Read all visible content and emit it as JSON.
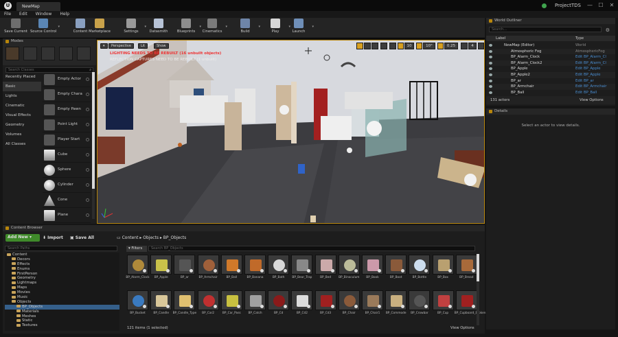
{
  "app": {
    "tab_title": "NewMap",
    "project": "ProjectTDS",
    "close": "✕",
    "minimize": "—",
    "maximize": "☐"
  },
  "menu": [
    "File",
    "Edit",
    "Window",
    "Help"
  ],
  "toolbar": [
    {
      "label": "Save Current",
      "color": "#6e6e6e"
    },
    {
      "label": "Source Control",
      "color": "#5a86b5"
    },
    {
      "label": "Content",
      "color": "#8aa0c0"
    },
    {
      "label": "Marketplace",
      "color": "#c9a24a"
    },
    {
      "label": "Settings",
      "color": "#9a9a9a"
    },
    {
      "label": "Datasmith",
      "color": "#b7c3d6"
    },
    {
      "label": "Blueprints",
      "color": "#8d8d8d"
    },
    {
      "label": "Cinematics",
      "color": "#7a7a7a"
    },
    {
      "label": "Build",
      "color": "#6e85a8"
    },
    {
      "label": "Play",
      "color": "#d6d6d6"
    },
    {
      "label": "Launch",
      "color": "#6f8fb8"
    }
  ],
  "modes": {
    "title": "Modes",
    "search_placeholder": "Search Classes",
    "categories": [
      "Recently Placed",
      "Basic",
      "Lights",
      "Cinematic",
      "Visual Effects",
      "Geometry",
      "Volumes",
      "All Classes"
    ],
    "items": [
      "Empty Actor",
      "Empty Chara",
      "Empty Pawn",
      "Point Light",
      "Player Start",
      "Cube",
      "Sphere",
      "Cylinder",
      "Cone",
      "Plane"
    ]
  },
  "viewport": {
    "perspective": "Perspective",
    "lit": "Lit",
    "show": "Show",
    "warning1": "LIGHTING NEEDS TO BE REBUILT (16 unbuilt objects)",
    "warning2": "REFLECTION CAPTURES NEED TO BE REBUILT (1 unbuilt)",
    "grid_snap": "10",
    "rot_snap": "10°",
    "scale_snap": "0.25",
    "cam_speed": "4"
  },
  "outliner": {
    "title": "World Outliner",
    "search_placeholder": "Search...",
    "col_label": "Label",
    "col_type": "Type",
    "rows": [
      {
        "name": "NewMap (Editor)",
        "type": "World",
        "link": false
      },
      {
        "name": "Atmospheric Fog",
        "type": "AtmosphericFog",
        "link": false
      },
      {
        "name": "BP_Alarm_Clock",
        "type": "Edit BP_Alarm_Cl",
        "link": true
      },
      {
        "name": "BP_Alarm_Clock2",
        "type": "Edit BP_Alarm_Cl",
        "link": true
      },
      {
        "name": "BP_Apple",
        "type": "Edit BP_Apple",
        "link": true
      },
      {
        "name": "BP_Apple2",
        "type": "Edit BP_Apple",
        "link": true
      },
      {
        "name": "BP_ar",
        "type": "Edit BP_ar",
        "link": true
      },
      {
        "name": "BP_Armchair",
        "type": "Edit BP_Armchair",
        "link": true
      },
      {
        "name": "BP_Ball",
        "type": "Edit BP_Ball",
        "link": true
      }
    ],
    "count": "131 actors",
    "view_options": "View Options"
  },
  "details": {
    "title": "Details",
    "empty": "Select an actor to view details."
  },
  "content_browser": {
    "title": "Content Browser",
    "add_new": "Add New",
    "import": "Import",
    "save_all": "Save All",
    "path": [
      "Content",
      "Objects",
      "BP_Objects"
    ],
    "search_paths": "Search Paths",
    "filters": "Filters",
    "search_assets": "Search BP_Objects",
    "tree": [
      {
        "label": "Content",
        "depth": 0
      },
      {
        "label": "Decors",
        "depth": 1
      },
      {
        "label": "Effects",
        "depth": 1
      },
      {
        "label": "Enums",
        "depth": 1
      },
      {
        "label": "FirstPerson",
        "depth": 1
      },
      {
        "label": "Geometry",
        "depth": 1
      },
      {
        "label": "Lightmaps",
        "depth": 1
      },
      {
        "label": "Maps",
        "depth": 1
      },
      {
        "label": "Movies",
        "depth": 1
      },
      {
        "label": "Music",
        "depth": 1
      },
      {
        "label": "Objects",
        "depth": 1
      },
      {
        "label": "BP_Objects",
        "depth": 2,
        "sel": true
      },
      {
        "label": "Materials",
        "depth": 2
      },
      {
        "label": "Meshes",
        "depth": 2
      },
      {
        "label": "Static",
        "depth": 2
      },
      {
        "label": "Textures",
        "depth": 2
      }
    ],
    "assets_row1": [
      {
        "label": "BP_Alarm_Clock",
        "color": "#b08a3a"
      },
      {
        "label": "BP_Apple",
        "color": "#c9c24a"
      },
      {
        "label": "BP_ar",
        "color": "#555"
      },
      {
        "label": "BP_Armchair",
        "color": "#a0603a"
      },
      {
        "label": "BP_Ball",
        "color": "#d0792a"
      },
      {
        "label": "BP_Banana",
        "color": "#c06a2a"
      },
      {
        "label": "BP_Bath",
        "color": "#d8d8d8"
      },
      {
        "label": "BP_Bear_Trap",
        "color": "#888"
      },
      {
        "label": "BP_Bed",
        "color": "#caa"
      },
      {
        "label": "BP_Binoculum",
        "color": "#bb9"
      },
      {
        "label": "BP_Book",
        "color": "#c9a"
      },
      {
        "label": "BP_Boot",
        "color": "#8a5a3a"
      },
      {
        "label": "BP_Bottle",
        "color": "#cde"
      },
      {
        "label": "BP_Box",
        "color": "#b9a070"
      },
      {
        "label": "BP_Bread",
        "color": "#a86a3a"
      }
    ],
    "assets_row2": [
      {
        "label": "BP_Bucket",
        "color": "#3a7ac0"
      },
      {
        "label": "BP_Candle",
        "color": "#d9c79a"
      },
      {
        "label": "BP_Candle_Type",
        "color": "#e0c070"
      },
      {
        "label": "BP_Car2",
        "color": "#c03030"
      },
      {
        "label": "BP_Car_Pass",
        "color": "#c8c040"
      },
      {
        "label": "BP_Catch",
        "color": "#a0a0a0"
      },
      {
        "label": "BP_Cd",
        "color": "#8a1a1a"
      },
      {
        "label": "BP_Cd2",
        "color": "#ddd"
      },
      {
        "label": "BP_Cd3",
        "color": "#a02020"
      },
      {
        "label": "BP_Chair",
        "color": "#8a5a3a"
      },
      {
        "label": "BP_Chair1",
        "color": "#9a7a5a"
      },
      {
        "label": "BP_Commode",
        "color": "#c9b080"
      },
      {
        "label": "BP_Crowbar",
        "color": "#555"
      },
      {
        "label": "BP_Cup",
        "color": "#c04040"
      },
      {
        "label": "BP_Cupboard_Broken",
        "color": "#a02020"
      }
    ],
    "status": "121 items (1 selected)",
    "view_options": "View Options"
  }
}
